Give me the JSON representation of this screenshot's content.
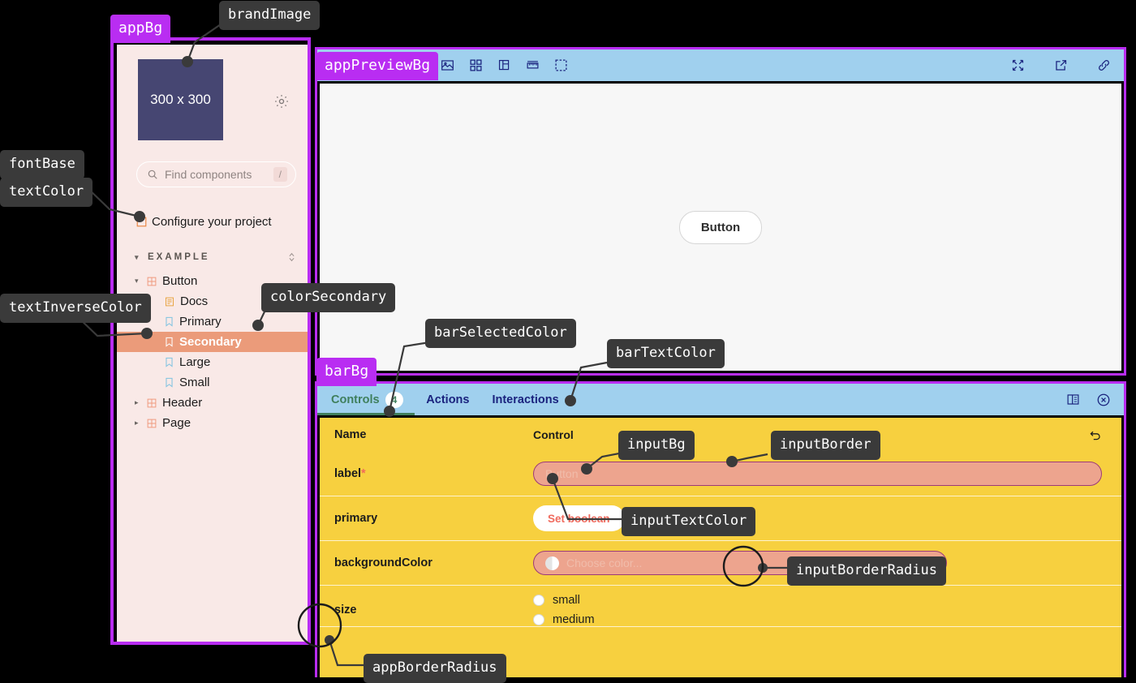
{
  "annotations": {
    "appBg": "appBg",
    "brandImage": "brandImage",
    "fontBase": "fontBase",
    "textColor": "textColor",
    "textInverseColor": "textInverseColor",
    "colorSecondary": "colorSecondary",
    "appPreviewBg": "appPreviewBg",
    "barBg": "barBg",
    "barSelectedColor": "barSelectedColor",
    "barTextColor": "barTextColor",
    "inputBg": "inputBg",
    "inputBorder": "inputBorder",
    "inputTextColor": "inputTextColor",
    "inputBorderRadius": "inputBorderRadius",
    "appBorderRadius": "appBorderRadius"
  },
  "sidebar": {
    "brand_image_label": "300 x 300",
    "settings_icon": "gear-icon",
    "search": {
      "placeholder": "Find components",
      "shortcut": "/",
      "icon": "search-icon"
    },
    "configure_link": "Configure your project",
    "section": {
      "label": "EXAMPLE",
      "caret": "▾",
      "sort_icon": "sort-updown-icon"
    },
    "tree": [
      {
        "label": "Button",
        "level": 0,
        "caret": "▾",
        "icon": "component-icon",
        "selected": false
      },
      {
        "label": "Docs",
        "level": 1,
        "caret": "",
        "icon": "document-icon",
        "selected": false
      },
      {
        "label": "Primary",
        "level": 1,
        "caret": "",
        "icon": "story-icon",
        "selected": false
      },
      {
        "label": "Secondary",
        "level": 1,
        "caret": "",
        "icon": "story-icon",
        "selected": true
      },
      {
        "label": "Large",
        "level": 1,
        "caret": "",
        "icon": "story-icon",
        "selected": false
      },
      {
        "label": "Small",
        "level": 1,
        "caret": "",
        "icon": "story-icon",
        "selected": false
      },
      {
        "label": "Header",
        "level": 0,
        "caret": "▸",
        "icon": "component-icon",
        "selected": false
      },
      {
        "label": "Page",
        "level": 0,
        "caret": "▸",
        "icon": "component-icon",
        "selected": false
      }
    ]
  },
  "preview": {
    "toolbar_left": [
      "background-image-icon",
      "grid-icon",
      "copy-layers-icon",
      "ruler-icon",
      "measure-icon"
    ],
    "toolbar_right": [
      "fullscreen-icon",
      "open-in-new-tab-icon",
      "link-icon"
    ],
    "button_label": "Button"
  },
  "panel": {
    "tabs": [
      {
        "label": "Controls",
        "badge": "4",
        "active": true
      },
      {
        "label": "Actions",
        "badge": "",
        "active": false
      },
      {
        "label": "Interactions",
        "badge": "",
        "active": false
      }
    ],
    "tab_icons": [
      "panel-layout-icon",
      "close-circle-icon"
    ],
    "columns": {
      "name": "Name",
      "control": "Control"
    },
    "reset_icon": "undo-icon",
    "rows": [
      {
        "name": "label",
        "required": "*",
        "control_type": "text",
        "placeholder": "Button"
      },
      {
        "name": "primary",
        "required": "",
        "control_type": "boolean",
        "button_label": "Set boolean"
      },
      {
        "name": "backgroundColor",
        "required": "",
        "control_type": "color",
        "placeholder": "Choose color..."
      },
      {
        "name": "size",
        "required": "",
        "control_type": "radio",
        "options": [
          "small",
          "medium"
        ]
      }
    ]
  },
  "colors": {
    "accent_purple": "#b92df2",
    "app_bg": "#f9e9e7",
    "bar_bg": "#a0d0ee",
    "panel_bg": "#f7d03f",
    "brand_image_bg": "#464672",
    "color_secondary": "#eb9b7a",
    "input_bg": "#eda48e",
    "input_border": "#9c3a78",
    "input_text": "#f06b5e",
    "bar_selected": "#3f7f5c",
    "bar_text": "#1a237e",
    "text_color": "#1b1b1b",
    "text_inverse": "#ffffff",
    "preview_bg": "#f7f7f7"
  }
}
